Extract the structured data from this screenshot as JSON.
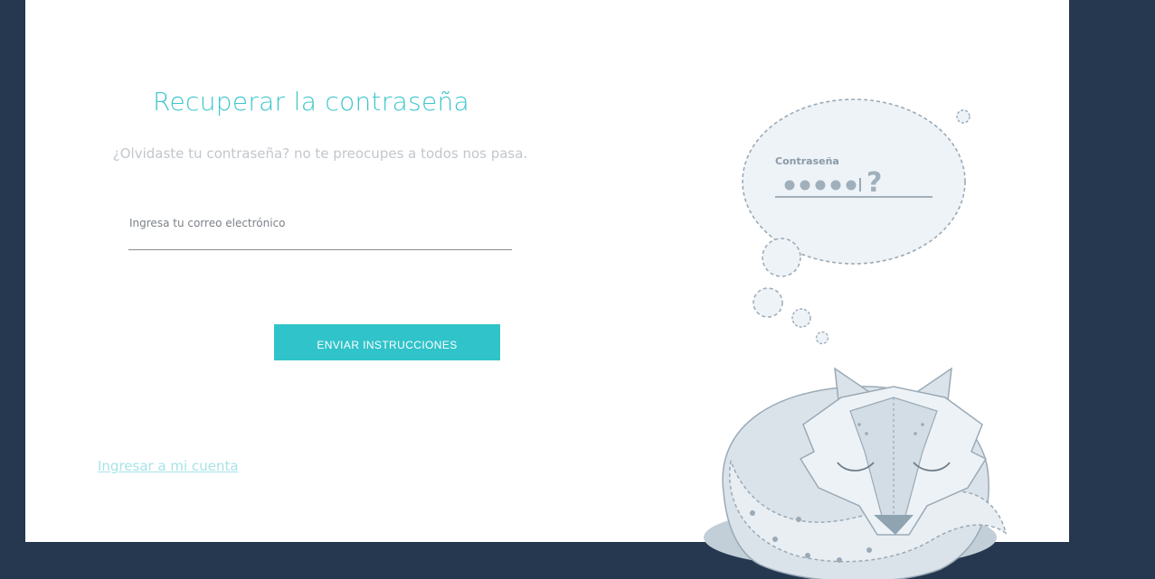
{
  "page": {
    "title": "Recuperar la contraseña",
    "subtitle": "¿Olvidaste tu contraseña? no te preocupes a todos nos pasa."
  },
  "form": {
    "email_label": "Ingresa tu correo electrónico",
    "email_value": "",
    "submit_label": "ENVIAR INSTRUCCIONES"
  },
  "footer": {
    "login_link": "Ingresar a mi cuenta"
  },
  "illustration": {
    "thought_label": "Contraseña",
    "question_mark": "?"
  },
  "colors": {
    "background": "#253850",
    "accent": "#30c3ca",
    "card": "#ffffff"
  }
}
